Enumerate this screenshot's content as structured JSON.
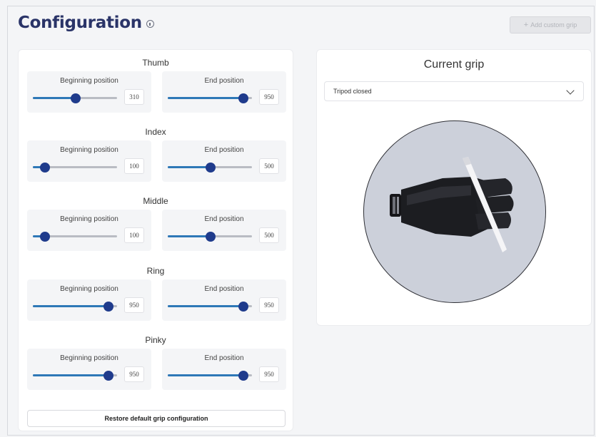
{
  "header": {
    "title": "Configuration",
    "add_button_label": "Add custom grip"
  },
  "fingers": [
    {
      "name": "Thumb",
      "begin_label": "Beginning position",
      "begin_value": "310",
      "end_label": "End position",
      "end_value": "950"
    },
    {
      "name": "Index",
      "begin_label": "Beginning position",
      "begin_value": "100",
      "end_label": "End position",
      "end_value": "500"
    },
    {
      "name": "Middle",
      "begin_label": "Beginning position",
      "begin_value": "100",
      "end_label": "End position",
      "end_value": "500"
    },
    {
      "name": "Ring",
      "begin_label": "Beginning position",
      "begin_value": "950",
      "end_label": "End position",
      "end_value": "950"
    },
    {
      "name": "Pinky",
      "begin_label": "Beginning position",
      "begin_value": "950",
      "end_label": "End position",
      "end_value": "950"
    }
  ],
  "restore_button_label": "Restore default grip configuration",
  "current_grip": {
    "title": "Current grip",
    "selected": "Tripod closed"
  },
  "colors": {
    "accent": "#2e78b7",
    "thumb": "#1f3b8c",
    "title": "#2a3468"
  }
}
